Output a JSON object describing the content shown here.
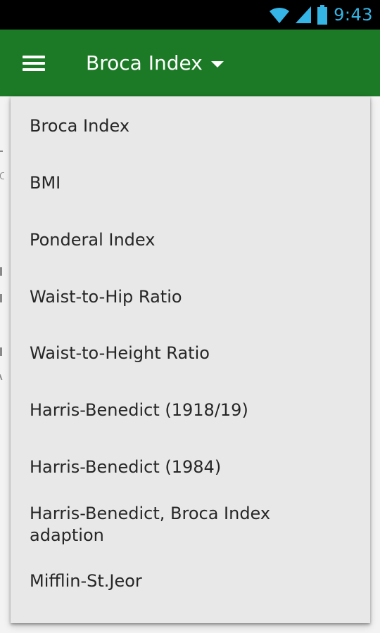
{
  "status_bar": {
    "time": "9:43",
    "icons": [
      "wifi-icon",
      "cell-signal-icon",
      "battery-icon"
    ],
    "icon_color": "#35b5e5"
  },
  "app_bar": {
    "title": "Broca Index",
    "menu_icon": "hamburger-menu-icon",
    "dropdown_icon": "caret-down-icon",
    "color": "#1c7a26"
  },
  "dropdown": {
    "items": [
      {
        "label": "Broca Index"
      },
      {
        "label": "BMI"
      },
      {
        "label": "Ponderal Index"
      },
      {
        "label": "Waist-to-Hip Ratio"
      },
      {
        "label": "Waist-to-Height Ratio"
      },
      {
        "label": "Harris-Benedict (1918/19)"
      },
      {
        "label": "Harris-Benedict (1984)"
      },
      {
        "label": "Harris-Benedict, Broca Index adaption"
      },
      {
        "label": "Mifflin-St.Jeor"
      }
    ]
  }
}
